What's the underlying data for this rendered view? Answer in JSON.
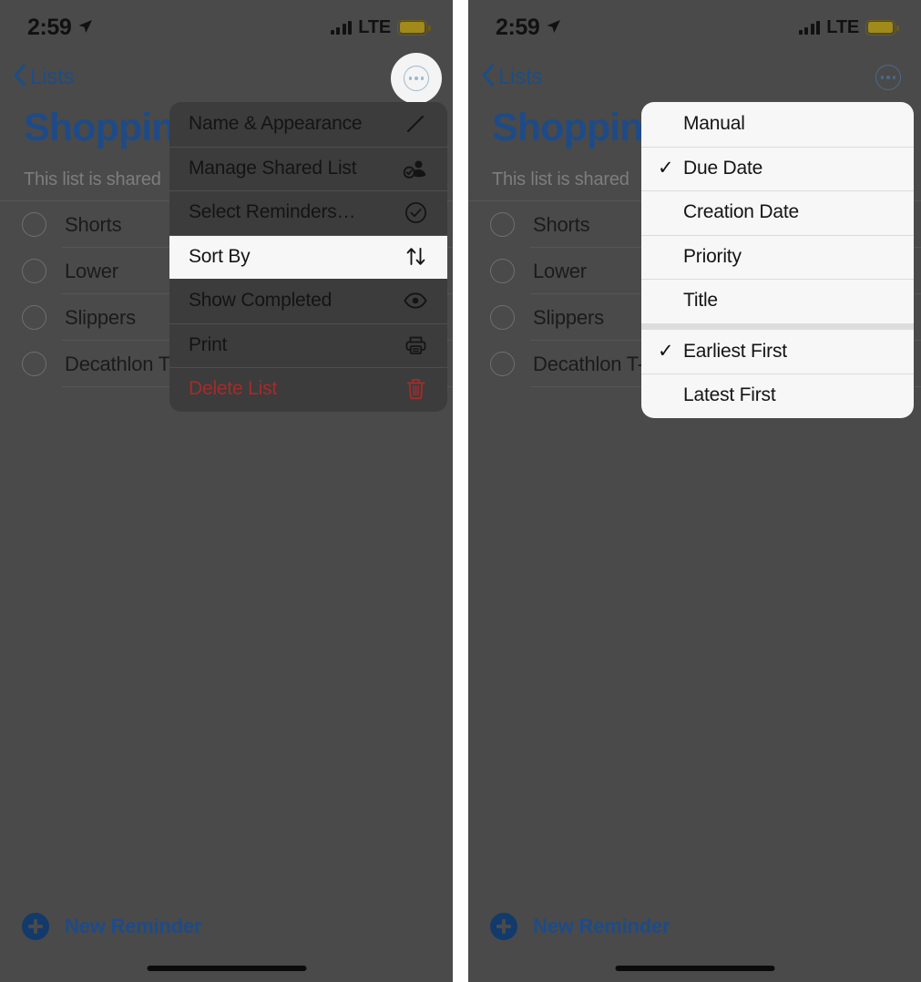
{
  "status_bar": {
    "time": "2:59",
    "location_icon": "location-arrow-icon",
    "signal_icon": "cellular-bars-icon",
    "carrier": "LTE",
    "battery_icon": "battery-icon",
    "battery_color": "#a08a1a"
  },
  "nav": {
    "back_label": "Lists",
    "back_icon": "chevron-left-icon",
    "more_icon": "ellipsis-circle-icon",
    "accent_color": "#1e4b87"
  },
  "list": {
    "title": "Shopping",
    "shared_note": "This list is shared",
    "items": [
      {
        "label": "Shorts"
      },
      {
        "label": "Lower"
      },
      {
        "label": "Slippers"
      },
      {
        "label": "Decathlon T-Shirt"
      }
    ],
    "new_reminder_label": "New Reminder",
    "new_reminder_icon": "plus-circle-icon"
  },
  "context_menu": {
    "items": [
      {
        "label": "Name & Appearance",
        "icon": "pencil-icon",
        "highlighted": false,
        "destructive": false
      },
      {
        "label": "Manage Shared List",
        "icon": "person-badge-icon",
        "highlighted": false,
        "destructive": false
      },
      {
        "label": "Select Reminders…",
        "icon": "checkmark-circle-icon",
        "highlighted": false,
        "destructive": false
      },
      {
        "label": "Sort By",
        "icon": "arrow-up-arrow-down-icon",
        "highlighted": true,
        "destructive": false
      },
      {
        "label": "Show Completed",
        "icon": "eye-icon",
        "highlighted": false,
        "destructive": false
      },
      {
        "label": "Print",
        "icon": "printer-icon",
        "highlighted": false,
        "destructive": false
      },
      {
        "label": "Delete List",
        "icon": "trash-icon",
        "highlighted": false,
        "destructive": true
      }
    ],
    "destructive_color": "#a52b2b"
  },
  "sort_menu": {
    "items": [
      {
        "label": "Manual",
        "checked": false,
        "group_start": false
      },
      {
        "label": "Due Date",
        "checked": true,
        "group_start": false
      },
      {
        "label": "Creation Date",
        "checked": false,
        "group_start": false
      },
      {
        "label": "Priority",
        "checked": false,
        "group_start": false
      },
      {
        "label": "Title",
        "checked": false,
        "group_start": false
      },
      {
        "label": "Earliest First",
        "checked": true,
        "group_start": true
      },
      {
        "label": "Latest First",
        "checked": false,
        "group_start": false
      }
    ],
    "check_glyph": "✓"
  }
}
